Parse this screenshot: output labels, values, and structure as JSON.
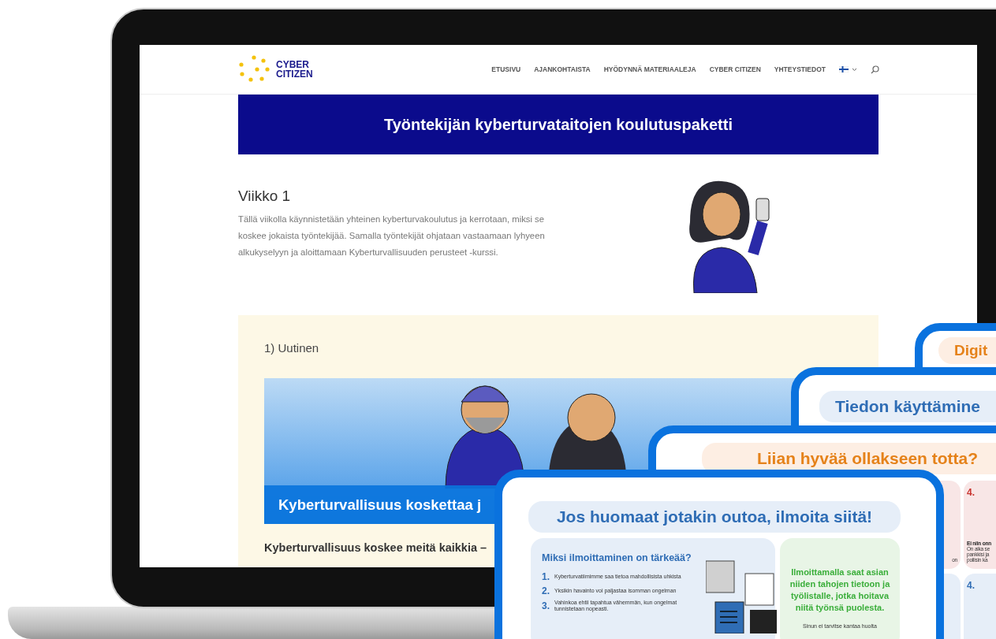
{
  "header": {
    "logo_text": "CYBER CITIZEN",
    "nav": [
      {
        "label": "ETUSIVU"
      },
      {
        "label": "AJANKOHTAISTA"
      },
      {
        "label": "HYÖDYNNÄ MATERIAALEJA"
      },
      {
        "label": "CYBER CITIZEN"
      },
      {
        "label": "YHTEYSTIEDOT"
      }
    ]
  },
  "banner": {
    "title": "Työntekijän kyberturvataitojen koulutuspaketti"
  },
  "week": {
    "heading": "Viikko 1",
    "text": "Tällä viikolla käynnistetään yhteinen kyberturvakoulutus ja kerrotaan, miksi se koskee jokaista työntekijää. Samalla työntekijät ohjataan vastaamaan lyhyeen alkukyselyyn ja aloittamaan Kyberturvallisuuden perusteet -kurssi."
  },
  "news": {
    "heading": "1) Uutinen",
    "image_caption": "Kyberturvallisuus koskettaa j",
    "lead": "Kyberturvallisuus koskee meitä kaikkia –"
  },
  "cards": [
    {
      "kind": "title",
      "title": "Digit",
      "color": "#e5821a"
    },
    {
      "kind": "title",
      "title": "Tiedon käyttämine",
      "color": "#2f6db5"
    },
    {
      "kind": "tiles",
      "title": "Liian hyvää ollakseen totta?",
      "color": "#e5821a",
      "tiles": [
        {
          "color": "#f8e6e6",
          "lines": [
            "on"
          ]
        },
        {
          "color": "#f8e6e6",
          "number": "4.",
          "heading": "Ei niin onn",
          "lines": [
            "On aika se",
            "pankkisi ja",
            "poliisin ka"
          ]
        },
        {
          "color": "#e6eef8"
        },
        {
          "color": "#e6eef8",
          "number": "4."
        }
      ]
    },
    {
      "kind": "report",
      "title": "Jos huomaat jotakin outoa, ilmoita siitä!",
      "color": "#2f6db5",
      "left_panel": {
        "heading": "Miksi ilmoittaminen on tärkeää?",
        "items": [
          {
            "number": "1.",
            "text": "Kyberturvatiimimme saa tietoa mahdollisista uhkista"
          },
          {
            "number": "2.",
            "text": "Yksikin havainto voi paljastaa isomman ongelman"
          },
          {
            "number": "3.",
            "text": "Vahinkoa ehtii tapahtua vähemmän, kun ongelmat tunnistetaan nopeasti."
          }
        ]
      },
      "right_panel": {
        "text": "Ilmoittamalla saat asian niiden tahojen tietoon ja työlistalle, jotka hoitava niitä työnsä puolesta.",
        "note": "Sinun ei tarvitse kantaa huolta"
      }
    }
  ]
}
